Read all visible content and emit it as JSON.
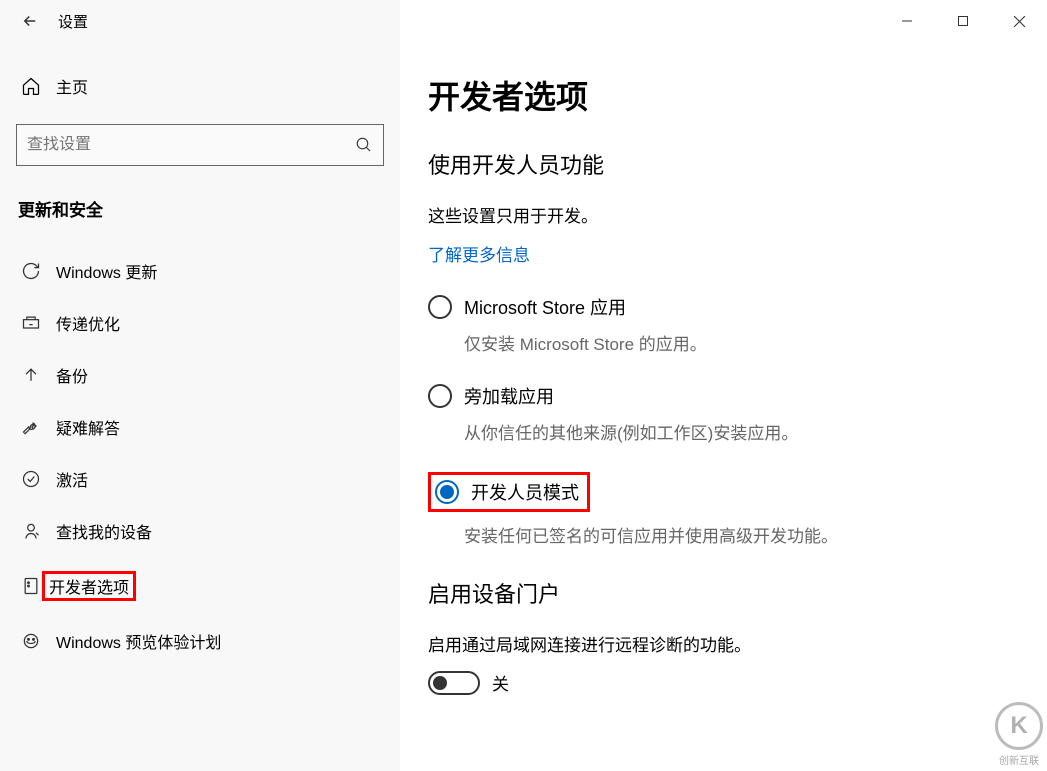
{
  "window": {
    "title": "设置"
  },
  "home": {
    "label": "主页"
  },
  "search": {
    "placeholder": "查找设置"
  },
  "section": {
    "title": "更新和安全"
  },
  "nav": [
    {
      "key": "windows-update",
      "label": "Windows 更新"
    },
    {
      "key": "delivery-optimization",
      "label": "传递优化"
    },
    {
      "key": "backup",
      "label": "备份"
    },
    {
      "key": "troubleshoot",
      "label": "疑难解答"
    },
    {
      "key": "activation",
      "label": "激活"
    },
    {
      "key": "find-my-device",
      "label": "查找我的设备"
    },
    {
      "key": "developer-options",
      "label": "开发者选项",
      "highlighted": true
    },
    {
      "key": "windows-insider",
      "label": "Windows 预览体验计划"
    }
  ],
  "main": {
    "title": "开发者选项",
    "section1": {
      "heading": "使用开发人员功能",
      "desc": "这些设置只用于开发。",
      "link": "了解更多信息"
    },
    "radios": [
      {
        "label": "Microsoft Store 应用",
        "desc": "仅安装 Microsoft Store 的应用。",
        "checked": false
      },
      {
        "label": "旁加载应用",
        "desc": "从你信任的其他来源(例如工作区)安装应用。",
        "checked": false
      },
      {
        "label": "开发人员模式",
        "desc": "安装任何已签名的可信应用并使用高级开发功能。",
        "checked": true,
        "highlighted": true
      }
    ],
    "section2": {
      "heading": "启用设备门户",
      "desc": "启用通过局域网连接进行远程诊断的功能。",
      "toggle": {
        "state": "off",
        "label": "关"
      }
    }
  },
  "watermark": {
    "brand": "创新互联",
    "logo": "K"
  }
}
